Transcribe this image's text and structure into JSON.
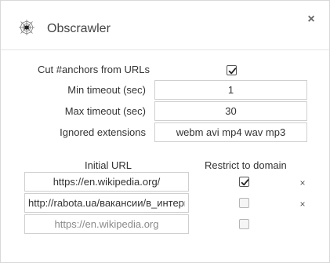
{
  "app": {
    "title": "Obscrawler",
    "close_label": "×"
  },
  "settings": {
    "cut_anchors": {
      "label": "Cut #anchors from URLs",
      "checked": true
    },
    "min_timeout": {
      "label": "Min timeout (sec)",
      "value": "1"
    },
    "max_timeout": {
      "label": "Max timeout (sec)",
      "value": "30"
    },
    "ignored_extensions": {
      "label": "Ignored extensions",
      "value": "webm avi mp4 wav mp3"
    }
  },
  "urls": {
    "col_initial_url": "Initial URL",
    "col_restrict": "Restrict to domain",
    "rows": [
      {
        "url": "https://en.wikipedia.org/",
        "restrict": true,
        "remove_label": "×"
      },
      {
        "url": "http://rabota.ua/вакансии/в_интерне",
        "restrict": false,
        "remove_label": "×"
      }
    ],
    "new_row": {
      "placeholder": "https://en.wikipedia.org",
      "restrict": false
    }
  }
}
